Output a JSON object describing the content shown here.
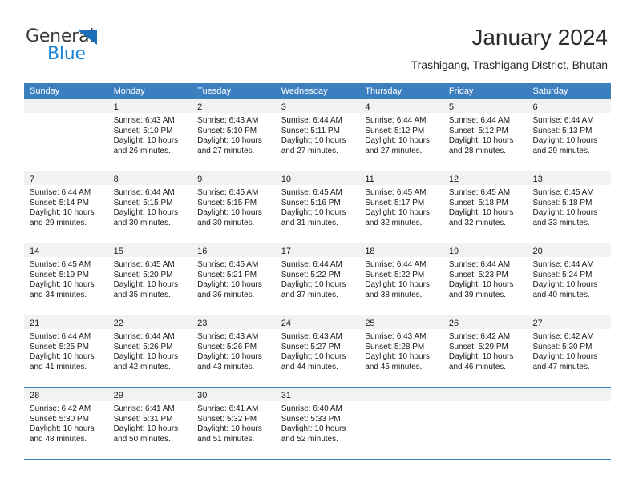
{
  "brand": {
    "name_part1": "General",
    "name_part2": "Blue",
    "triangle_icon": "triangle-icon",
    "colors": {
      "dark": "#3b3b3b",
      "blue": "#1c84d6",
      "triangle": "#1d6fb8"
    }
  },
  "header": {
    "title": "January 2024",
    "subtitle": "Trashigang, Trashigang District, Bhutan"
  },
  "calendar": {
    "accent_color": "#3c7fc1",
    "daynum_band_color": "#f2f2f2",
    "weekdays": [
      "Sunday",
      "Monday",
      "Tuesday",
      "Wednesday",
      "Thursday",
      "Friday",
      "Saturday"
    ],
    "weeks": [
      [
        {
          "day": "",
          "lines": []
        },
        {
          "day": "1",
          "lines": [
            "Sunrise: 6:43 AM",
            "Sunset: 5:10 PM",
            "Daylight: 10 hours",
            "and 26 minutes."
          ]
        },
        {
          "day": "2",
          "lines": [
            "Sunrise: 6:43 AM",
            "Sunset: 5:10 PM",
            "Daylight: 10 hours",
            "and 27 minutes."
          ]
        },
        {
          "day": "3",
          "lines": [
            "Sunrise: 6:44 AM",
            "Sunset: 5:11 PM",
            "Daylight: 10 hours",
            "and 27 minutes."
          ]
        },
        {
          "day": "4",
          "lines": [
            "Sunrise: 6:44 AM",
            "Sunset: 5:12 PM",
            "Daylight: 10 hours",
            "and 27 minutes."
          ]
        },
        {
          "day": "5",
          "lines": [
            "Sunrise: 6:44 AM",
            "Sunset: 5:12 PM",
            "Daylight: 10 hours",
            "and 28 minutes."
          ]
        },
        {
          "day": "6",
          "lines": [
            "Sunrise: 6:44 AM",
            "Sunset: 5:13 PM",
            "Daylight: 10 hours",
            "and 29 minutes."
          ]
        }
      ],
      [
        {
          "day": "7",
          "lines": [
            "Sunrise: 6:44 AM",
            "Sunset: 5:14 PM",
            "Daylight: 10 hours",
            "and 29 minutes."
          ]
        },
        {
          "day": "8",
          "lines": [
            "Sunrise: 6:44 AM",
            "Sunset: 5:15 PM",
            "Daylight: 10 hours",
            "and 30 minutes."
          ]
        },
        {
          "day": "9",
          "lines": [
            "Sunrise: 6:45 AM",
            "Sunset: 5:15 PM",
            "Daylight: 10 hours",
            "and 30 minutes."
          ]
        },
        {
          "day": "10",
          "lines": [
            "Sunrise: 6:45 AM",
            "Sunset: 5:16 PM",
            "Daylight: 10 hours",
            "and 31 minutes."
          ]
        },
        {
          "day": "11",
          "lines": [
            "Sunrise: 6:45 AM",
            "Sunset: 5:17 PM",
            "Daylight: 10 hours",
            "and 32 minutes."
          ]
        },
        {
          "day": "12",
          "lines": [
            "Sunrise: 6:45 AM",
            "Sunset: 5:18 PM",
            "Daylight: 10 hours",
            "and 32 minutes."
          ]
        },
        {
          "day": "13",
          "lines": [
            "Sunrise: 6:45 AM",
            "Sunset: 5:18 PM",
            "Daylight: 10 hours",
            "and 33 minutes."
          ]
        }
      ],
      [
        {
          "day": "14",
          "lines": [
            "Sunrise: 6:45 AM",
            "Sunset: 5:19 PM",
            "Daylight: 10 hours",
            "and 34 minutes."
          ]
        },
        {
          "day": "15",
          "lines": [
            "Sunrise: 6:45 AM",
            "Sunset: 5:20 PM",
            "Daylight: 10 hours",
            "and 35 minutes."
          ]
        },
        {
          "day": "16",
          "lines": [
            "Sunrise: 6:45 AM",
            "Sunset: 5:21 PM",
            "Daylight: 10 hours",
            "and 36 minutes."
          ]
        },
        {
          "day": "17",
          "lines": [
            "Sunrise: 6:44 AM",
            "Sunset: 5:22 PM",
            "Daylight: 10 hours",
            "and 37 minutes."
          ]
        },
        {
          "day": "18",
          "lines": [
            "Sunrise: 6:44 AM",
            "Sunset: 5:22 PM",
            "Daylight: 10 hours",
            "and 38 minutes."
          ]
        },
        {
          "day": "19",
          "lines": [
            "Sunrise: 6:44 AM",
            "Sunset: 5:23 PM",
            "Daylight: 10 hours",
            "and 39 minutes."
          ]
        },
        {
          "day": "20",
          "lines": [
            "Sunrise: 6:44 AM",
            "Sunset: 5:24 PM",
            "Daylight: 10 hours",
            "and 40 minutes."
          ]
        }
      ],
      [
        {
          "day": "21",
          "lines": [
            "Sunrise: 6:44 AM",
            "Sunset: 5:25 PM",
            "Daylight: 10 hours",
            "and 41 minutes."
          ]
        },
        {
          "day": "22",
          "lines": [
            "Sunrise: 6:44 AM",
            "Sunset: 5:26 PM",
            "Daylight: 10 hours",
            "and 42 minutes."
          ]
        },
        {
          "day": "23",
          "lines": [
            "Sunrise: 6:43 AM",
            "Sunset: 5:26 PM",
            "Daylight: 10 hours",
            "and 43 minutes."
          ]
        },
        {
          "day": "24",
          "lines": [
            "Sunrise: 6:43 AM",
            "Sunset: 5:27 PM",
            "Daylight: 10 hours",
            "and 44 minutes."
          ]
        },
        {
          "day": "25",
          "lines": [
            "Sunrise: 6:43 AM",
            "Sunset: 5:28 PM",
            "Daylight: 10 hours",
            "and 45 minutes."
          ]
        },
        {
          "day": "26",
          "lines": [
            "Sunrise: 6:42 AM",
            "Sunset: 5:29 PM",
            "Daylight: 10 hours",
            "and 46 minutes."
          ]
        },
        {
          "day": "27",
          "lines": [
            "Sunrise: 6:42 AM",
            "Sunset: 5:30 PM",
            "Daylight: 10 hours",
            "and 47 minutes."
          ]
        }
      ],
      [
        {
          "day": "28",
          "lines": [
            "Sunrise: 6:42 AM",
            "Sunset: 5:30 PM",
            "Daylight: 10 hours",
            "and 48 minutes."
          ]
        },
        {
          "day": "29",
          "lines": [
            "Sunrise: 6:41 AM",
            "Sunset: 5:31 PM",
            "Daylight: 10 hours",
            "and 50 minutes."
          ]
        },
        {
          "day": "30",
          "lines": [
            "Sunrise: 6:41 AM",
            "Sunset: 5:32 PM",
            "Daylight: 10 hours",
            "and 51 minutes."
          ]
        },
        {
          "day": "31",
          "lines": [
            "Sunrise: 6:40 AM",
            "Sunset: 5:33 PM",
            "Daylight: 10 hours",
            "and 52 minutes."
          ]
        },
        {
          "day": "",
          "lines": []
        },
        {
          "day": "",
          "lines": []
        },
        {
          "day": "",
          "lines": []
        }
      ]
    ]
  }
}
